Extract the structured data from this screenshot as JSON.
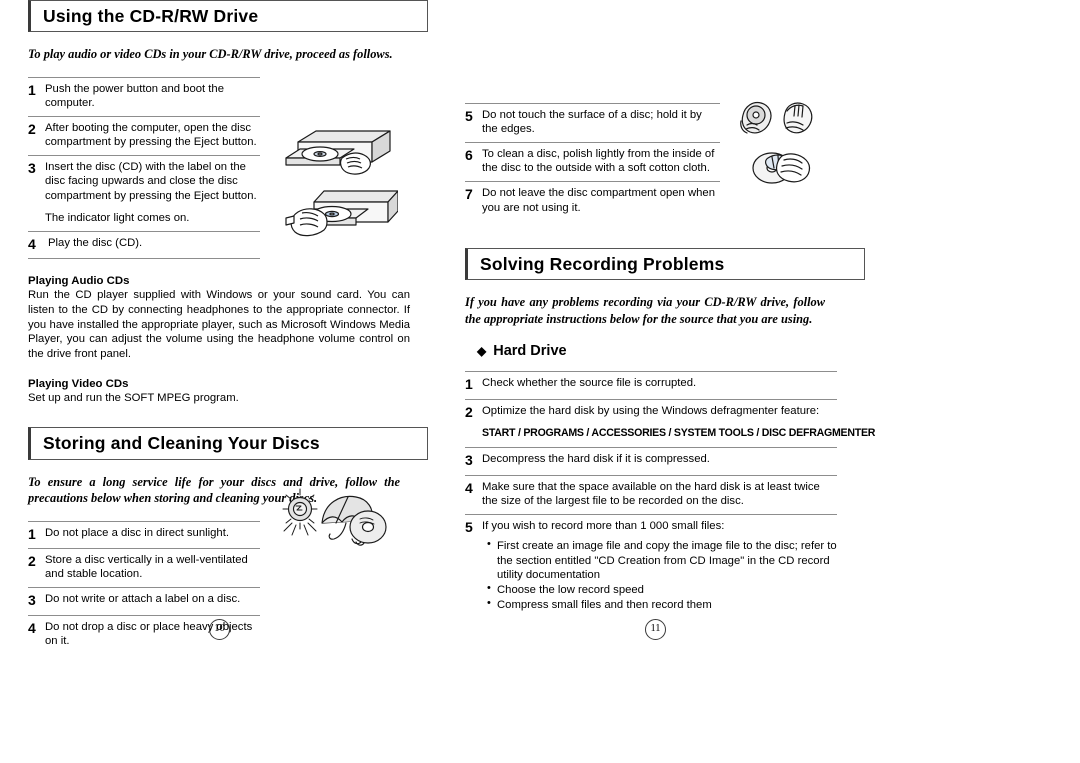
{
  "document": {
    "type": "manual-spread",
    "left_page_number": "10",
    "right_page_number": "11"
  },
  "left_page": {
    "section1": {
      "heading": "Using the CD-R/RW Drive",
      "intro": "To play audio or video CDs in your CD-R/RW drive, proceed as follows.",
      "steps": [
        {
          "num": "1",
          "text": "Push the power button and boot the computer."
        },
        {
          "num": "2",
          "text": "After booting the computer, open the disc compartment by pressing the Eject button."
        },
        {
          "num": "3",
          "text": "Insert the disc (CD) with the label on the disc facing upwards and close the disc compartment by pressing the Eject button.",
          "sub": "The indicator light comes on."
        },
        {
          "num": "4",
          "text": "Play the disc (CD)."
        }
      ],
      "subsections": [
        {
          "title": "Playing Audio CDs",
          "body": "Run the CD player supplied with Windows or your sound card. You can listen to the CD by connecting headphones to the appropriate connector. If you have installed the appropriate player, such as Microsoft Windows Media Player, you can adjust the volume using the headphone volume control on the drive front panel."
        },
        {
          "title": "Playing Video CDs",
          "body": "Set up and run the SOFT MPEG program."
        }
      ]
    },
    "section2": {
      "heading": "Storing and Cleaning Your Discs",
      "intro": "To ensure a long service life for your discs and drive, follow the precautions below when storing and cleaning your discs.",
      "steps": [
        {
          "num": "1",
          "text": "Do not place a disc in direct sunlight."
        },
        {
          "num": "2",
          "text": "Store a disc vertically in a well-ventilated and stable location."
        },
        {
          "num": "3",
          "text": "Do not write or attach a label on a disc."
        },
        {
          "num": "4",
          "text": "Do not drop a disc or place heavy objects on it."
        }
      ]
    }
  },
  "right_page": {
    "continued_steps": [
      {
        "num": "5",
        "text": "Do not touch the surface of a disc; hold it by the edges."
      },
      {
        "num": "6",
        "text": "To clean a disc, polish lightly from the inside of the disc to the outside with a soft cotton cloth."
      },
      {
        "num": "7",
        "text": "Do not leave the disc compartment open when you are not using it."
      }
    ],
    "section3": {
      "heading": "Solving Recording Problems",
      "intro": "If you have any problems recording via your CD-R/RW drive, follow the appropriate instructions below for the source that you are using.",
      "subheading": "Hard Drive",
      "subheading_bullet": "◆",
      "steps": [
        {
          "num": "1",
          "text": "Check whether the source file is corrupted."
        },
        {
          "num": "2",
          "text": "Optimize the hard disk by using the Windows defragmenter feature:",
          "mono": "START / PROGRAMS / ACCESSORIES / SYSTEM TOOLS / DISC DEFRAGMENTER"
        },
        {
          "num": "3",
          "text": "Decompress the hard disk if it is compressed."
        },
        {
          "num": "4",
          "text": "Make sure that the space available on the hard disk is at least twice the size of the largest file to be recorded on the disc."
        },
        {
          "num": "5",
          "text": "If you wish to record more than 1 000 small files:",
          "bullets": [
            "First create an image file and copy the image file to the disc; refer to the section entitled \"CD Creation from CD Image\" in the CD record utility documentation",
            "Choose the low record speed",
            "Compress small files and then record them"
          ]
        }
      ]
    }
  },
  "illustrations": [
    {
      "name": "cd-drive-open-tray-with-hand",
      "caption": ""
    },
    {
      "name": "cd-drive-inserting-disc-with-hand",
      "caption": ""
    },
    {
      "name": "sun-and-umbrella-over-disc",
      "caption": ""
    },
    {
      "name": "hands-holding-disc",
      "caption": ""
    },
    {
      "name": "hand-cleaning-disc-with-cloth",
      "caption": ""
    }
  ],
  "colors": {
    "text": "#000000",
    "rule": "#8d8d8d",
    "box_border": "#555555",
    "background": "#ffffff"
  }
}
